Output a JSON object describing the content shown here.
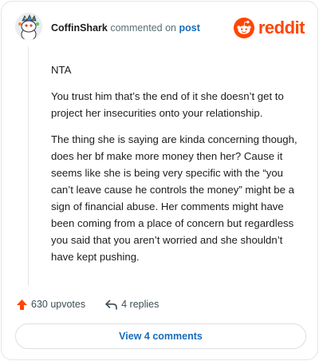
{
  "header": {
    "username": "CoffinShark",
    "action_text": "commented on",
    "post_link": "post",
    "brand": "reddit",
    "avatar_icon": "snoo-avatar-icon",
    "brand_icon": "reddit-alien-icon"
  },
  "comment": {
    "paragraphs": [
      "NTA",
      "You trust him that’s the end of it she doesn’t get to project her insecurities onto your relationship.",
      "The thing she is saying are kinda concerning though, does her bf make more money then her? Cause it seems like she is being very specific with the “you can’t leave cause he controls the money” might be a sign of financial abuse. Her comments might have been coming from a place of concern but regardless you said that you aren’t worried and she shouldn’t have kept pushing."
    ]
  },
  "actions": {
    "upvotes": "630 upvotes",
    "replies": "4 replies",
    "upvote_icon": "upvote-arrow-icon",
    "reply_icon": "reply-arrow-icon"
  },
  "footer": {
    "view_comments": "View 4 comments"
  },
  "colors": {
    "accent": "#ff4500",
    "link": "#1a6bb8",
    "text": "#1c1c1c",
    "muted": "#576f76",
    "border": "#e2e5e8"
  }
}
